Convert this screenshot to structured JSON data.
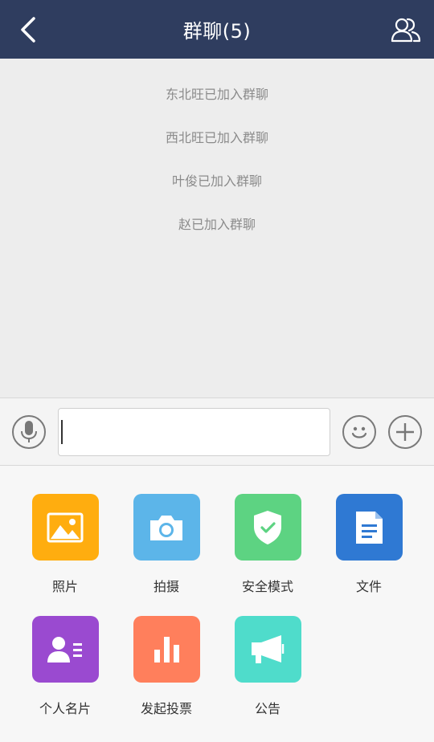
{
  "header": {
    "title": "群聊(5)",
    "back_icon": "chevron-left-icon",
    "members_icon": "group-members-icon",
    "background": "#2f3d5f"
  },
  "chat": {
    "system_messages": [
      "东北旺已加入群聊",
      "西北旺已加入群聊",
      "叶俊已加入群聊",
      "赵已加入群聊"
    ]
  },
  "input_bar": {
    "voice_icon": "microphone-icon",
    "text_value": "",
    "emoji_icon": "smiley-icon",
    "more_icon": "plus-icon"
  },
  "panel": {
    "items": [
      {
        "label": "照片",
        "icon": "image-icon",
        "color": "#ffad0f"
      },
      {
        "label": "拍摄",
        "icon": "camera-icon",
        "color": "#5cb5e9"
      },
      {
        "label": "安全模式",
        "icon": "shield-check-icon",
        "color": "#5dd382"
      },
      {
        "label": "文件",
        "icon": "document-icon",
        "color": "#2f79d3"
      },
      {
        "label": "个人名片",
        "icon": "contact-card-icon",
        "color": "#9a4ad0"
      },
      {
        "label": "发起投票",
        "icon": "bar-chart-icon",
        "color": "#ff7f5c"
      },
      {
        "label": "公告",
        "icon": "megaphone-icon",
        "color": "#4fdccb"
      }
    ]
  }
}
